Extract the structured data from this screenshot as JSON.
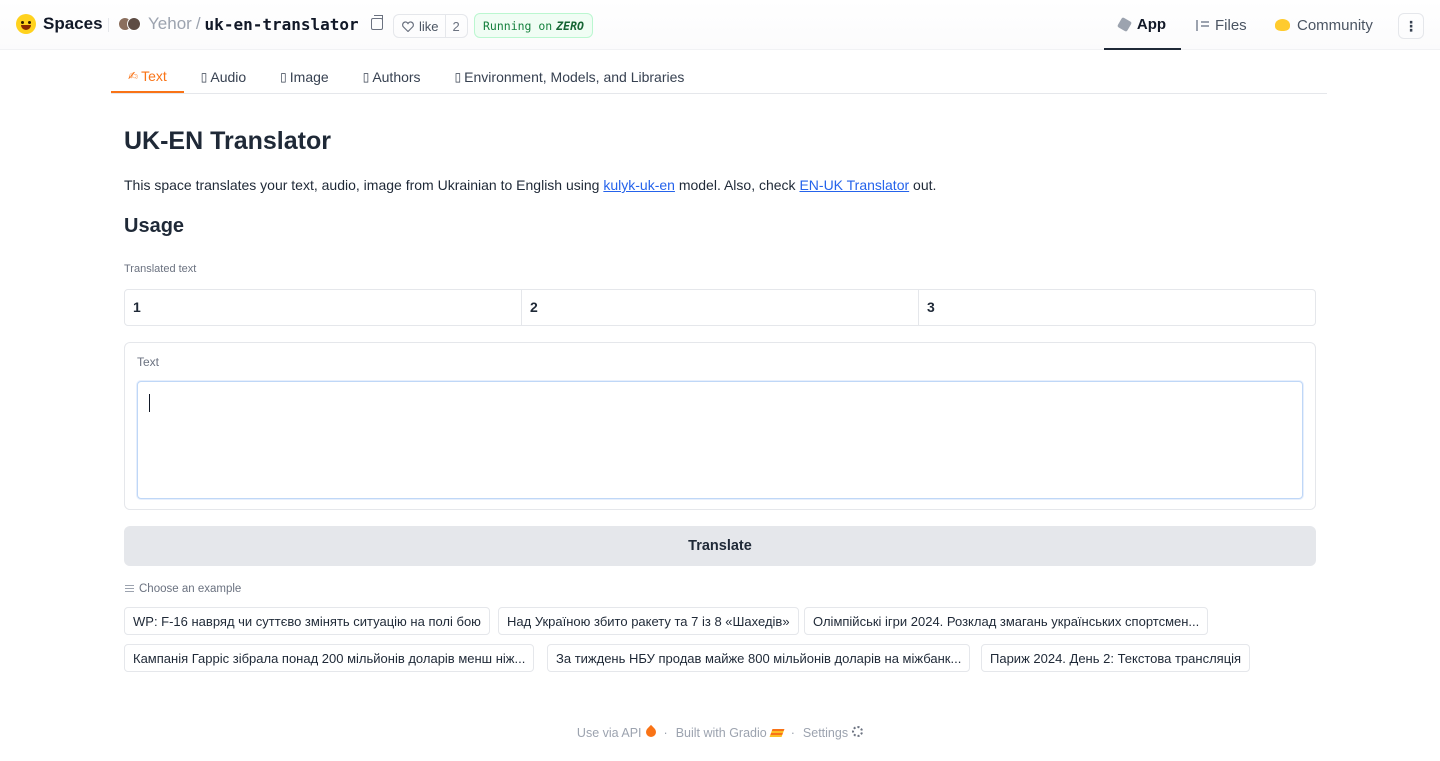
{
  "header": {
    "brand": "Spaces",
    "owner": "Yehor",
    "separator": "/",
    "repo": "uk-en-translator",
    "like_label": "like",
    "like_count": "2",
    "running_prefix": "Running on",
    "running_hw": "ZERO",
    "nav": {
      "app": "App",
      "files": "Files",
      "community": "Community"
    },
    "more": "⋮"
  },
  "tabs": [
    {
      "icon": "✍",
      "label": "Text"
    },
    {
      "icon": "▯",
      "label": "Audio"
    },
    {
      "icon": "▯",
      "label": "Image"
    },
    {
      "icon": "▯",
      "label": "Authors"
    },
    {
      "icon": "▯",
      "label": "Environment, Models, and Libraries"
    }
  ],
  "main": {
    "title": "UK-EN Translator",
    "desc_pre": "This space translates your text, audio, image from Ukrainian to English using ",
    "desc_link1": "kulyk-uk-en",
    "desc_mid": " model. Also, check ",
    "desc_link2": "EN-UK Translator",
    "desc_post": " out.",
    "usage_heading": "Usage",
    "output_label": "Translated text",
    "output_columns": [
      "1",
      "2",
      "3"
    ],
    "input_label": "Text",
    "input_value": "",
    "translate_label": "Translate",
    "examples_label": "Choose an example",
    "examples": [
      "WP: F-16 навряд чи суттєво змінять ситуацію на полі бою",
      "Над Україною збито ракету та 7 із 8 «Шахедів»",
      "Олімпійські ігри 2024. Розклад змагань українських спортсмен...",
      "Кампанія Гарріс зібрала понад 200 мільйонів доларів менш ніж...",
      "За тиждень НБУ продав майже 800 мільйонів доларів на міжбанк...",
      "Париж 2024. День 2: Текстова трансляція"
    ]
  },
  "footer": {
    "api": "Use via API",
    "built": "Built with Gradio",
    "settings": "Settings",
    "dot": "·"
  }
}
